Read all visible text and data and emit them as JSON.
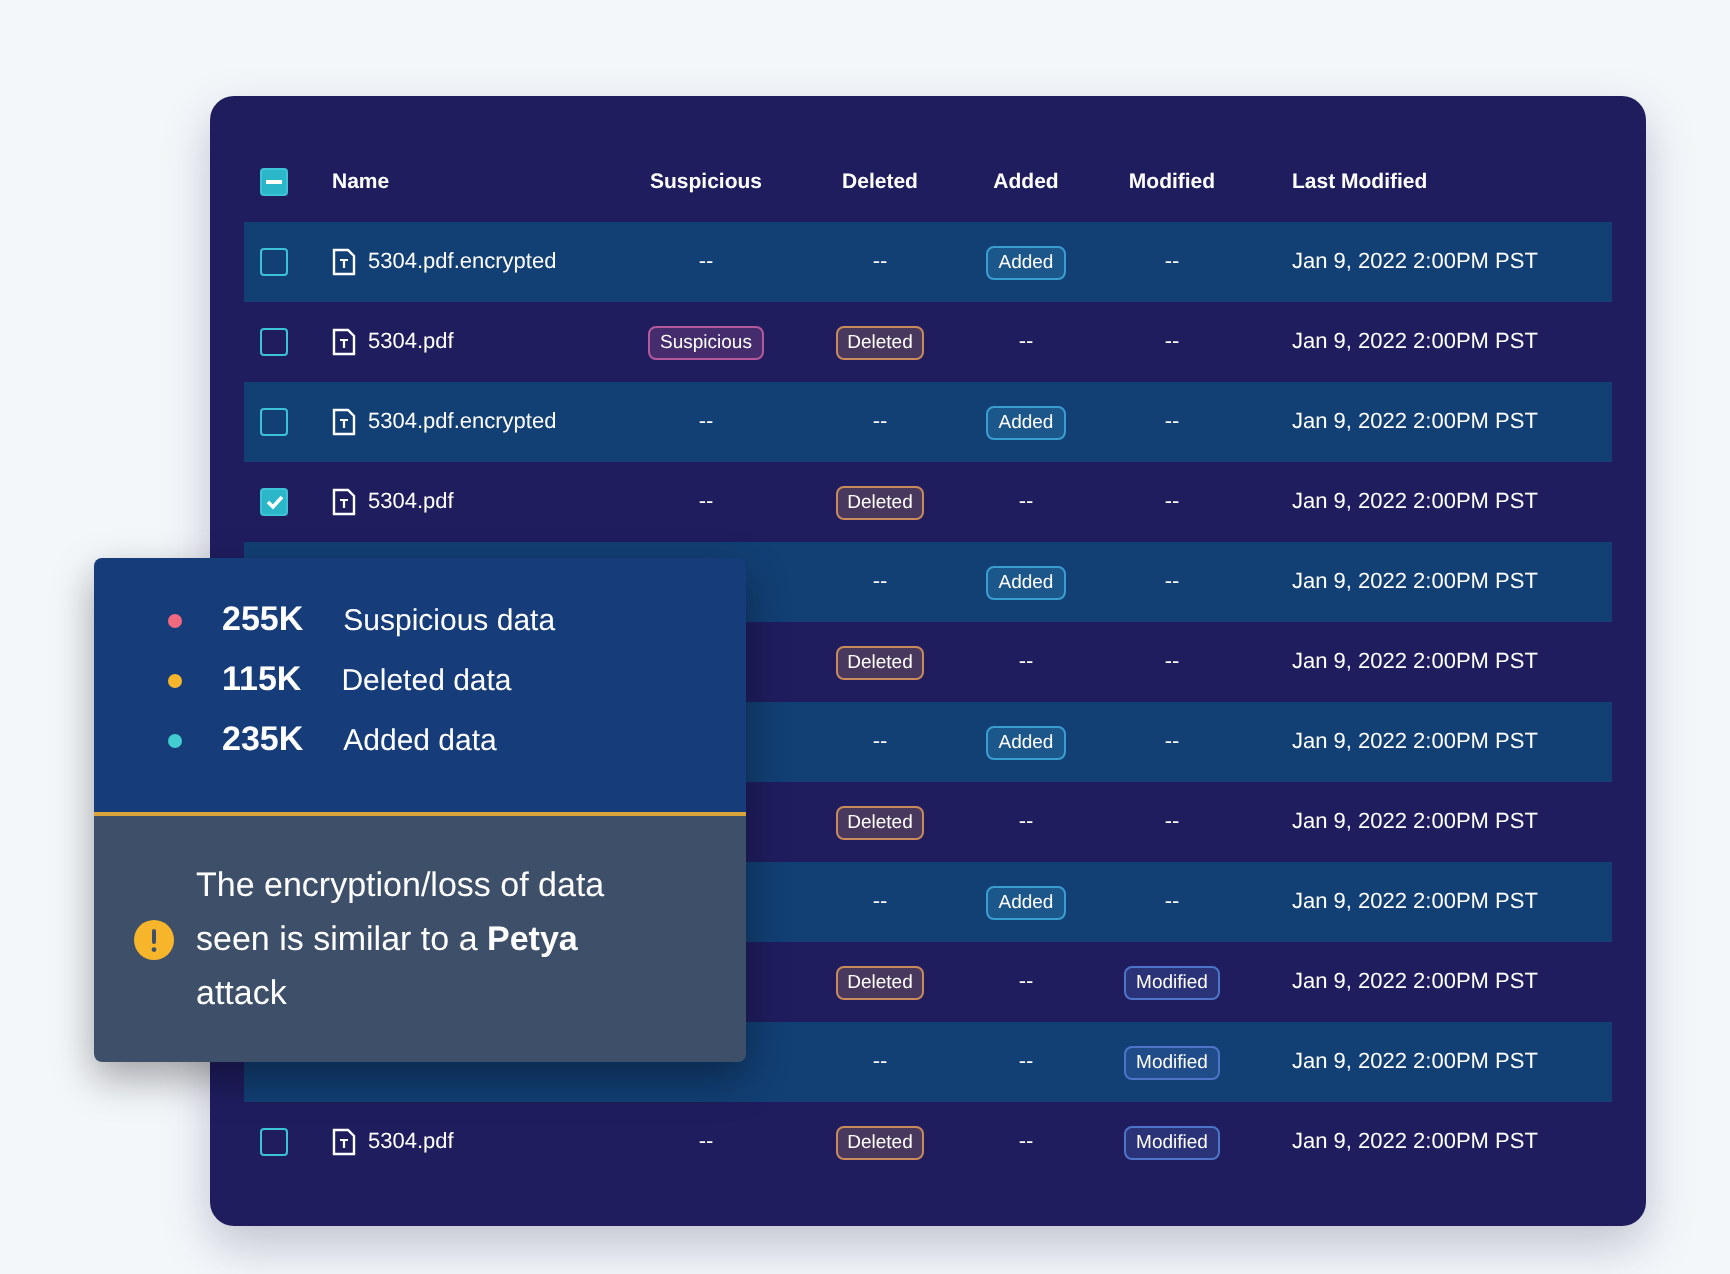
{
  "table": {
    "select_all": {
      "indeterminate": true
    },
    "columns": [
      "Name",
      "Suspicious",
      "Deleted",
      "Added",
      "Modified",
      "Last Modified"
    ],
    "rows": [
      {
        "checked": false,
        "cells": [
          {
            "kind": "file",
            "text": "5304.pdf.encrypted"
          },
          {
            "kind": "dash",
            "text": "--"
          },
          {
            "kind": "dash",
            "text": "--"
          },
          {
            "kind": "badge",
            "text": "Added",
            "color": "#3a9fd0"
          },
          {
            "kind": "dash",
            "text": "--"
          },
          {
            "kind": "date",
            "text": "Jan 9, 2022 2:00PM PST"
          }
        ]
      },
      {
        "checked": false,
        "cells": [
          {
            "kind": "file",
            "text": "5304.pdf"
          },
          {
            "kind": "badge",
            "text": "Suspicious",
            "color": "#b45a9c"
          },
          {
            "kind": "badge",
            "text": "Deleted",
            "color": "#c98a5c"
          },
          {
            "kind": "dash",
            "text": "--"
          },
          {
            "kind": "dash",
            "text": "--"
          },
          {
            "kind": "date",
            "text": "Jan 9, 2022 2:00PM PST"
          }
        ]
      },
      {
        "checked": false,
        "cells": [
          {
            "kind": "file",
            "text": "5304.pdf.encrypted"
          },
          {
            "kind": "dash",
            "text": "--"
          },
          {
            "kind": "dash",
            "text": "--"
          },
          {
            "kind": "badge",
            "text": "Added",
            "color": "#3a9fd0"
          },
          {
            "kind": "dash",
            "text": "--"
          },
          {
            "kind": "date",
            "text": "Jan 9, 2022 2:00PM PST"
          }
        ]
      },
      {
        "checked": true,
        "cells": [
          {
            "kind": "file",
            "text": "5304.pdf"
          },
          {
            "kind": "dash",
            "text": "--"
          },
          {
            "kind": "badge",
            "text": "Deleted",
            "color": "#c98a5c"
          },
          {
            "kind": "dash",
            "text": "--"
          },
          {
            "kind": "dash",
            "text": "--"
          },
          {
            "kind": "date",
            "text": "Jan 9, 2022 2:00PM PST"
          }
        ]
      },
      {
        "cells": [
          null,
          null,
          {
            "kind": "dash",
            "text": "--"
          },
          {
            "kind": "badge",
            "text": "Added",
            "color": "#3a9fd0"
          },
          {
            "kind": "dash",
            "text": "--"
          },
          {
            "kind": "date",
            "text": "Jan 9, 2022 2:00PM PST"
          }
        ]
      },
      {
        "cells": [
          null,
          null,
          {
            "kind": "badge",
            "text": "Deleted",
            "color": "#c98a5c"
          },
          {
            "kind": "dash",
            "text": "--"
          },
          {
            "kind": "dash",
            "text": "--"
          },
          {
            "kind": "date",
            "text": "Jan 9, 2022 2:00PM PST"
          }
        ]
      },
      {
        "cells": [
          null,
          null,
          {
            "kind": "dash",
            "text": "--"
          },
          {
            "kind": "badge",
            "text": "Added",
            "color": "#3a9fd0"
          },
          {
            "kind": "dash",
            "text": "--"
          },
          {
            "kind": "date",
            "text": "Jan 9, 2022 2:00PM PST"
          }
        ]
      },
      {
        "cells": [
          null,
          null,
          {
            "kind": "badge",
            "text": "Deleted",
            "color": "#c98a5c"
          },
          {
            "kind": "dash",
            "text": "--"
          },
          {
            "kind": "dash",
            "text": "--"
          },
          {
            "kind": "date",
            "text": "Jan 9, 2022 2:00PM PST"
          }
        ]
      },
      {
        "cells": [
          null,
          null,
          {
            "kind": "dash",
            "text": "--"
          },
          {
            "kind": "badge",
            "text": "Added",
            "color": "#3a9fd0"
          },
          {
            "kind": "dash",
            "text": "--"
          },
          {
            "kind": "date",
            "text": "Jan 9, 2022 2:00PM PST"
          }
        ]
      },
      {
        "cells": [
          null,
          null,
          {
            "kind": "badge",
            "text": "Deleted",
            "color": "#c98a5c"
          },
          {
            "kind": "dash",
            "text": "--"
          },
          {
            "kind": "badge",
            "text": "Modified",
            "color": "#4d74c8"
          },
          {
            "kind": "date",
            "text": "Jan 9, 2022 2:00PM PST"
          }
        ]
      },
      {
        "cells": [
          null,
          null,
          {
            "kind": "dash",
            "text": "--"
          },
          {
            "kind": "dash",
            "text": "--"
          },
          {
            "kind": "badge",
            "text": "Modified",
            "color": "#4d74c8"
          },
          {
            "kind": "date",
            "text": "Jan 9, 2022 2:00PM PST"
          }
        ]
      },
      {
        "checked": false,
        "cells": [
          {
            "kind": "file",
            "text": "5304.pdf"
          },
          {
            "kind": "dash",
            "text": "--"
          },
          {
            "kind": "badge",
            "text": "Deleted",
            "color": "#c98a5c"
          },
          {
            "kind": "dash",
            "text": "--"
          },
          {
            "kind": "badge",
            "text": "Modified",
            "color": "#4d74c8"
          },
          {
            "kind": "date",
            "text": "Jan 9, 2022 2:00PM PST"
          }
        ]
      }
    ]
  },
  "summary": {
    "stats": [
      {
        "value": "255K",
        "label": "Suspicious data",
        "color": "#f0697e"
      },
      {
        "value": "115K",
        "label": "Deleted data",
        "color": "#f7b52c"
      },
      {
        "value": "235K",
        "label": "Added data",
        "color": "#43cdd0"
      }
    ],
    "alert": {
      "text": "The encryption/loss of data seen is similar to a **Petya** attack"
    }
  }
}
